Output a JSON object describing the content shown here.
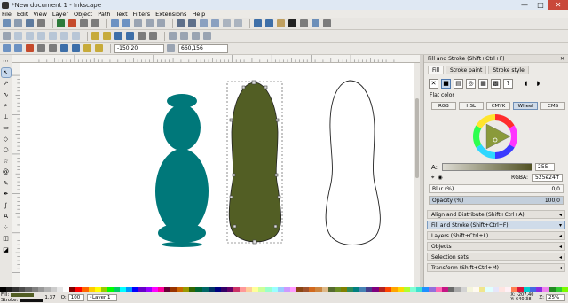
{
  "window": {
    "title": "*New document 1 - Inkscape"
  },
  "menu": [
    "File",
    "Edit",
    "View",
    "Layer",
    "Object",
    "Path",
    "Text",
    "Filters",
    "Extensions",
    "Help"
  ],
  "controls": {
    "x_value": "-150,20",
    "y_value": "660,156"
  },
  "panel": {
    "title": "Fill and Stroke (Shift+Ctrl+F)",
    "tabs": [
      "Fill",
      "Stroke paint",
      "Stroke style"
    ],
    "flat_label": "Flat color",
    "modes": [
      "RGB",
      "HSL",
      "CMYK",
      "Wheel",
      "CMS"
    ],
    "alpha_label": "A:",
    "alpha_value": "255",
    "rgba_label": "RGBA:",
    "rgba_value": "525e24ff",
    "blur_label": "Blur (%)",
    "blur_value": "0,0",
    "opacity_label": "Opacity (%)",
    "opacity_value": "100,0"
  },
  "docks": [
    "Align and Distribute (Shift+Ctrl+A)",
    "Fill and Stroke (Shift+Ctrl+F)",
    "Layers (Shift+Ctrl+L)",
    "Objects",
    "Selection sets",
    "Transform (Shift+Ctrl+M)"
  ],
  "status": {
    "fill_label": "Fill:",
    "stroke_label": "Stroke:",
    "stroke_width": "1,37",
    "o_label": "O:",
    "opacity": "100",
    "layer": "•Layer 1",
    "x_coord": "X: -207,40",
    "y_coord": "Y: 640,38",
    "z_label": "Z:",
    "zoom": "25%"
  },
  "colors": {
    "teal": "#00787a",
    "olive": "#525e24",
    "selection": "#333333"
  }
}
